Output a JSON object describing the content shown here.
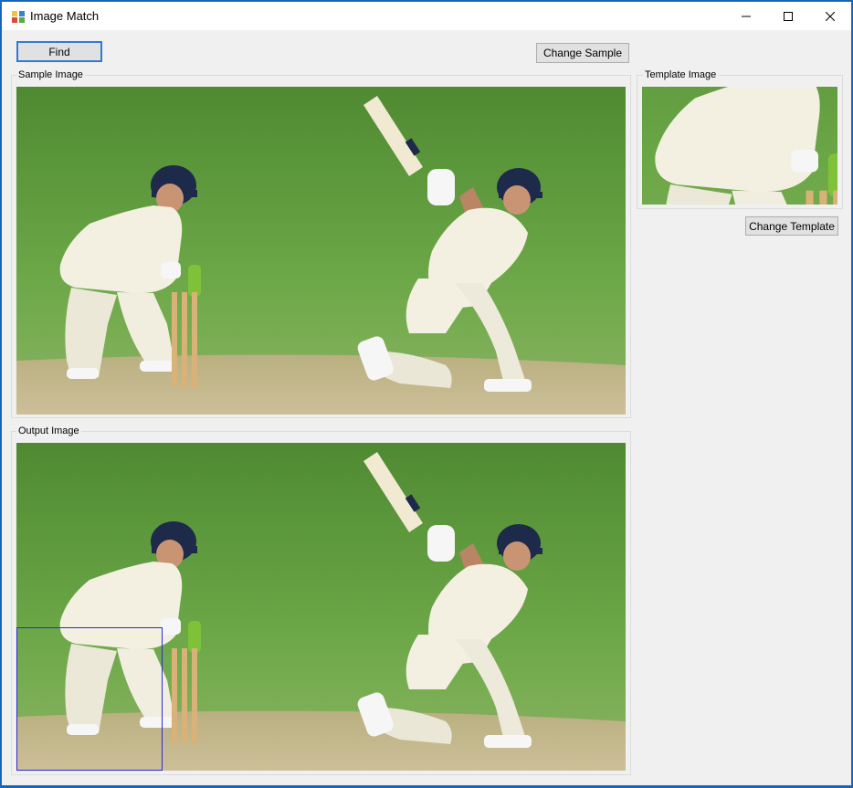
{
  "window": {
    "title": "Image Match",
    "controls": [
      "minimize-icon",
      "maximize-icon",
      "close-icon"
    ]
  },
  "toolbar": {
    "find_label": "Find",
    "change_sample_label": "Change Sample",
    "change_template_label": "Change Template"
  },
  "groups": {
    "sample_label": "Sample Image",
    "template_label": "Template Image",
    "output_label": "Output Image"
  },
  "colors": {
    "accent": "#2e7bd6",
    "window_bg": "#f0f0f0",
    "match_box": "#2b2bd6",
    "grass": "#5d9a3a",
    "pitch": "#c9b98f"
  }
}
